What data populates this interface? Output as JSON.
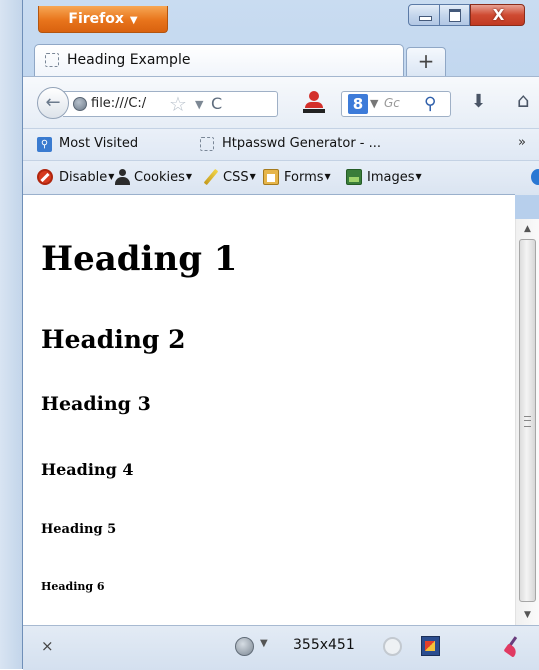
{
  "window": {
    "app_button_label": "Firefox",
    "app_button_caret": "▼",
    "close_glyph": "X"
  },
  "tabs": [
    {
      "title": "Heading Example"
    }
  ],
  "new_tab_label": "+",
  "navbar": {
    "back_glyph": "←",
    "url_text": "file:///C:/",
    "star_glyph": "☆",
    "dropdown_glyph": "▼",
    "reload_glyph": "C",
    "search_engine_letter": "8",
    "search_dropdown": "▼",
    "search_placeholder": "Gc",
    "search_glyph": "⚲",
    "download_glyph": "⬇",
    "home_glyph": "⌂"
  },
  "bookmarks": {
    "items": [
      {
        "label": "Most Visited",
        "icon": "most-visited-icon"
      },
      {
        "label": "Htpasswd Generator - ...",
        "icon": "page-icon"
      }
    ],
    "more_glyph": "»"
  },
  "devtoolbar": {
    "items": [
      {
        "label": "Disable",
        "icon": "disable-icon"
      },
      {
        "label": "Cookies",
        "icon": "cookies-icon"
      },
      {
        "label": "CSS",
        "icon": "css-icon"
      },
      {
        "label": "Forms",
        "icon": "forms-icon"
      },
      {
        "label": "Images",
        "icon": "images-icon"
      }
    ],
    "menu_arrow": "▼"
  },
  "content": {
    "h1": "Heading 1",
    "h2": "Heading 2",
    "h3": "Heading 3",
    "h4": "Heading 4",
    "h5": "Heading 5",
    "h6": "Heading 6"
  },
  "scrollbar": {
    "up_glyph": "▲",
    "down_glyph": "▼"
  },
  "statusbar": {
    "close_glyph": "×",
    "dropdown_glyph": "▼",
    "window_size": "355x451"
  },
  "colors": {
    "firefox_orange": "#e8741b",
    "window_frame": "#b9d0ec",
    "close_red": "#cf4b32"
  }
}
